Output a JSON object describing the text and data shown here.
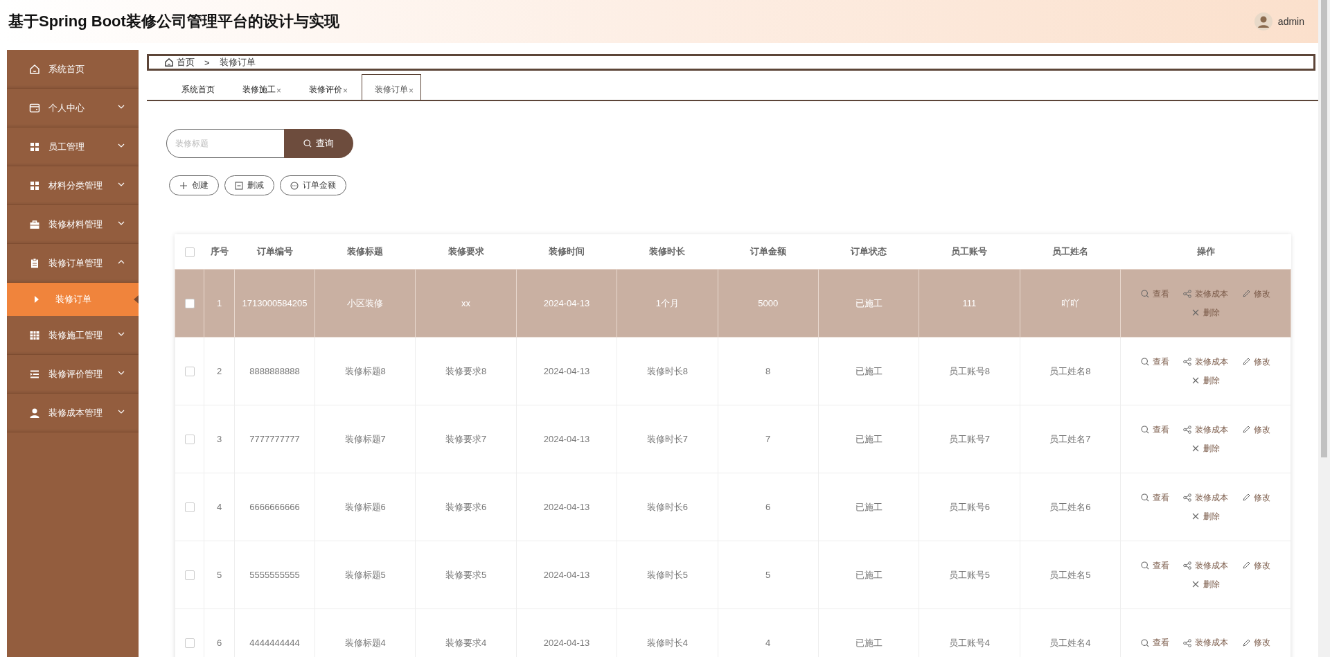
{
  "header": {
    "title": "基于Spring Boot装修公司管理平台的设计与实现",
    "user": "admin"
  },
  "sidebar": {
    "items": [
      {
        "kind": "home",
        "label": "系统首页"
      },
      {
        "kind": "card",
        "label": "个人中心",
        "expanded": false
      },
      {
        "kind": "grid",
        "label": "员工管理",
        "expanded": false
      },
      {
        "kind": "grid",
        "label": "材料分类管理",
        "expanded": false
      },
      {
        "kind": "briefcase",
        "label": "装修材料管理",
        "expanded": false
      },
      {
        "kind": "clipboard",
        "label": "装修订单管理",
        "expanded": true,
        "children": [
          {
            "label": "装修订单",
            "selected": true
          }
        ]
      },
      {
        "kind": "table",
        "label": "装修施工管理",
        "expanded": false
      },
      {
        "kind": "list",
        "label": "装修评价管理",
        "expanded": false
      },
      {
        "kind": "user",
        "label": "装修成本管理",
        "expanded": false
      }
    ]
  },
  "breadcrumb": {
    "home": "首页",
    "separator": ">",
    "current": "装修订单"
  },
  "tabs": [
    {
      "label": "系统首页",
      "selected": false
    },
    {
      "label": "装修施工",
      "close": "×",
      "selected": false
    },
    {
      "label": "装修评价",
      "close": "×",
      "selected": false
    },
    {
      "label": "装修订单",
      "close": "×",
      "selected": true
    }
  ],
  "search": {
    "placeholder": "装修标题",
    "button": "查询"
  },
  "toolbar": [
    {
      "kind": "add",
      "label": "创建"
    },
    {
      "kind": "remove",
      "label": "删减"
    },
    {
      "kind": "more",
      "label": "订单金额"
    }
  ],
  "table": {
    "all_checked": false,
    "columns": [
      "序号",
      "订单编号",
      "装修标题",
      "装修要求",
      "装修时间",
      "装修时长",
      "订单金额",
      "订单状态",
      "员工账号",
      "员工姓名",
      "操作"
    ],
    "rows": [
      {
        "selected": true,
        "cells": [
          "1",
          "1713000584205",
          "小区装修",
          "xx",
          "2024-04-13",
          "1个月",
          "5000",
          "已施工",
          "111",
          "吖吖"
        ],
        "actions": [
          {
            "kind": "view",
            "label": "查看"
          },
          {
            "kind": "cost",
            "label": "装修成本"
          },
          {
            "kind": "edit",
            "label": "修改"
          },
          {
            "kind": "delete",
            "label": "删除"
          }
        ]
      },
      {
        "selected": false,
        "cells": [
          "2",
          "8888888888",
          "装修标题8",
          "装修要求8",
          "2024-04-13",
          "装修时长8",
          "8",
          "已施工",
          "员工账号8",
          "员工姓名8"
        ],
        "actions": [
          {
            "kind": "view",
            "label": "查看"
          },
          {
            "kind": "cost",
            "label": "装修成本"
          },
          {
            "kind": "edit",
            "label": "修改"
          },
          {
            "kind": "delete",
            "label": "删除"
          }
        ]
      },
      {
        "selected": false,
        "cells": [
          "3",
          "7777777777",
          "装修标题7",
          "装修要求7",
          "2024-04-13",
          "装修时长7",
          "7",
          "已施工",
          "员工账号7",
          "员工姓名7"
        ],
        "actions": [
          {
            "kind": "view",
            "label": "查看"
          },
          {
            "kind": "cost",
            "label": "装修成本"
          },
          {
            "kind": "edit",
            "label": "修改"
          },
          {
            "kind": "delete",
            "label": "删除"
          }
        ]
      },
      {
        "selected": false,
        "cells": [
          "4",
          "6666666666",
          "装修标题6",
          "装修要求6",
          "2024-04-13",
          "装修时长6",
          "6",
          "已施工",
          "员工账号6",
          "员工姓名6"
        ],
        "actions": [
          {
            "kind": "view",
            "label": "查看"
          },
          {
            "kind": "cost",
            "label": "装修成本"
          },
          {
            "kind": "edit",
            "label": "修改"
          },
          {
            "kind": "delete",
            "label": "删除"
          }
        ]
      },
      {
        "selected": false,
        "cells": [
          "5",
          "5555555555",
          "装修标题5",
          "装修要求5",
          "2024-04-13",
          "装修时长5",
          "5",
          "已施工",
          "员工账号5",
          "员工姓名5"
        ],
        "actions": [
          {
            "kind": "view",
            "label": "查看"
          },
          {
            "kind": "cost",
            "label": "装修成本"
          },
          {
            "kind": "edit",
            "label": "修改"
          },
          {
            "kind": "delete",
            "label": "删除"
          }
        ]
      },
      {
        "selected": false,
        "cells": [
          "6",
          "4444444444",
          "装修标题4",
          "装修要求4",
          "2024-04-13",
          "装修时长4",
          "4",
          "已施工",
          "员工账号4",
          "员工姓名4"
        ],
        "actions": [
          {
            "kind": "view",
            "label": "查看"
          },
          {
            "kind": "cost",
            "label": "装修成本"
          },
          {
            "kind": "edit",
            "label": "修改"
          }
        ]
      }
    ]
  }
}
